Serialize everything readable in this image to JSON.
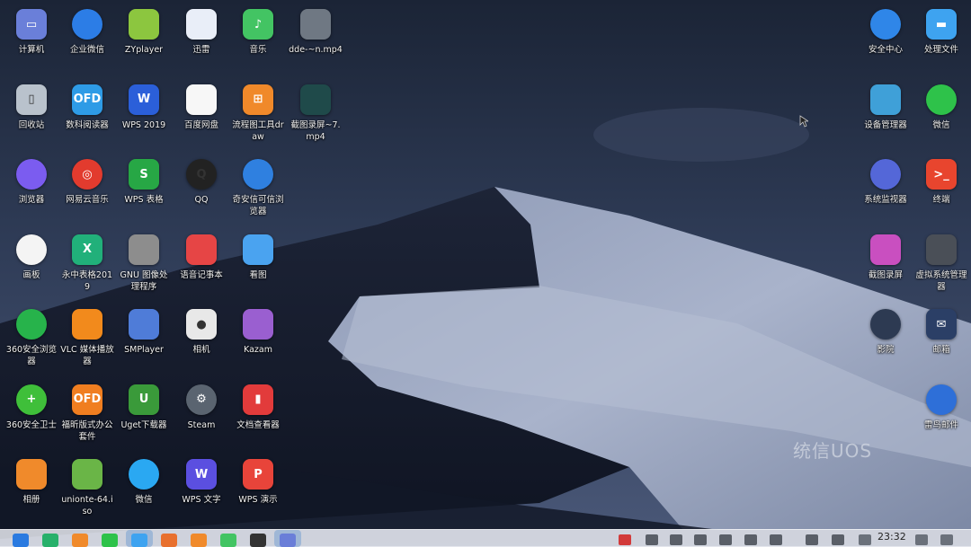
{
  "desktop": {
    "watermark": "统信UOS",
    "columns": [
      [
        {
          "label": "计算机",
          "icon": "computer-icon",
          "color": "#6a7fd9"
        },
        {
          "label": "回收站",
          "icon": "trash-icon",
          "color": "#b9c2cc"
        },
        {
          "label": "浏览器",
          "icon": "browser-icon",
          "color": "#7b5cf0"
        },
        {
          "label": "画板",
          "icon": "drawing-board-icon",
          "color": "#f4f4f4"
        },
        {
          "label": "360安全浏览器",
          "icon": "360-browser-icon",
          "color": "#27b34b"
        },
        {
          "label": "360安全卫士",
          "icon": "360-guard-icon",
          "color": "#3fbf3a"
        },
        {
          "label": "相册",
          "icon": "album-icon",
          "color": "#f08a2b"
        }
      ],
      [
        {
          "label": "企业微信",
          "icon": "wecom-icon",
          "color": "#2c7de6"
        },
        {
          "label": "数科阅读器",
          "icon": "ofd-reader-icon",
          "color": "#2e9be6"
        },
        {
          "label": "网易云音乐",
          "icon": "netease-music-icon",
          "color": "#e23b2e"
        },
        {
          "label": "永中表格2019",
          "icon": "yozo-sheet-icon",
          "color": "#21b07a"
        },
        {
          "label": "VLC 媒体播放器",
          "icon": "vlc-icon",
          "color": "#f28a1c"
        },
        {
          "label": "福昕版式办公套件",
          "icon": "foxit-ofd-icon",
          "color": "#f07e20"
        },
        {
          "label": "unionte-64.iso",
          "icon": "iso-file-icon",
          "color": "#6ab547"
        }
      ],
      [
        {
          "label": "ZYplayer",
          "icon": "zyplayer-icon",
          "color": "#8cc63f"
        },
        {
          "label": "WPS 2019",
          "icon": "wps-icon",
          "color": "#2b5fd9"
        },
        {
          "label": "WPS 表格",
          "icon": "wps-sheet-icon",
          "color": "#27a745"
        },
        {
          "label": "GNU 图像处理程序",
          "icon": "gimp-icon",
          "color": "#8d8d8d"
        },
        {
          "label": "SMPlayer",
          "icon": "smplayer-icon",
          "color": "#4f7cd8"
        },
        {
          "label": "Uget下载器",
          "icon": "uget-icon",
          "color": "#3a9a3a"
        },
        {
          "label": "微信",
          "icon": "wechat-icon",
          "color": "#2aa8f2"
        }
      ],
      [
        {
          "label": "迅雷",
          "icon": "xunlei-icon",
          "color": "#e9eef8"
        },
        {
          "label": "百度网盘",
          "icon": "baidu-netdisk-icon",
          "color": "#f7f7f7"
        },
        {
          "label": "QQ",
          "icon": "qq-icon",
          "color": "#222222"
        },
        {
          "label": "语音记事本",
          "icon": "voice-note-icon",
          "color": "#e64545"
        },
        {
          "label": "相机",
          "icon": "camera-icon",
          "color": "#e8e8e8"
        },
        {
          "label": "Steam",
          "icon": "steam-icon",
          "color": "#5a6470"
        },
        {
          "label": "WPS 文字",
          "icon": "wps-writer-icon",
          "color": "#5b4fe0"
        }
      ],
      [
        {
          "label": "音乐",
          "icon": "music-icon",
          "color": "#43c463"
        },
        {
          "label": "流程图工具draw",
          "icon": "drawio-icon",
          "color": "#f0892a"
        },
        {
          "label": "奇安信可信浏览器",
          "icon": "qianxin-browser-icon",
          "color": "#2f80e0"
        },
        {
          "label": "看图",
          "icon": "image-viewer-icon",
          "color": "#4aa3f0"
        },
        {
          "label": "Kazam",
          "icon": "kazam-icon",
          "color": "#9a5fd0"
        },
        {
          "label": "文档查看器",
          "icon": "document-viewer-icon",
          "color": "#e23b3b"
        },
        {
          "label": "WPS 演示",
          "icon": "wps-presentation-icon",
          "color": "#e8443a"
        }
      ],
      [
        {
          "label": "dde-~n.mp4",
          "icon": "video-file-icon",
          "color": "#6f7883"
        },
        {
          "label": "截图录屏~7.mp4",
          "icon": "video-thumbnail-icon",
          "color": "#1f4a4a"
        }
      ]
    ],
    "right_columns": [
      [
        {
          "label": "安全中心",
          "icon": "security-center-icon",
          "color": "#2f86e8"
        },
        {
          "label": "设备管理器",
          "icon": "device-manager-icon",
          "color": "#3fa0d8"
        },
        {
          "label": "系统监视器",
          "icon": "system-monitor-icon",
          "color": "#5467d8"
        },
        {
          "label": "截图录屏",
          "icon": "screenshot-icon",
          "color": "#c94fc0"
        },
        {
          "label": "影院",
          "icon": "movie-icon",
          "color": "#2d3a52"
        }
      ],
      [
        {
          "label": "处理文件",
          "icon": "folder-icon",
          "color": "#3ea3f0"
        },
        {
          "label": "微信",
          "icon": "wechat-icon",
          "color": "#2ec24a"
        },
        {
          "label": "终端",
          "icon": "terminal-icon",
          "color": "#e8452e"
        },
        {
          "label": "虚拟系统管理器",
          "icon": "virtual-manager-icon",
          "color": "#4a4f57"
        },
        {
          "label": "邮箱",
          "icon": "mail-icon",
          "color": "#2b3f66"
        },
        {
          "label": "雷鸟邮件",
          "icon": "thunderbird-icon",
          "color": "#2e6fd8"
        }
      ]
    ]
  },
  "dock": {
    "apps": [
      {
        "icon": "launcher-icon",
        "color": "#2a7ae0"
      },
      {
        "icon": "spreadsheet-icon",
        "color": "#27b06a"
      },
      {
        "icon": "store-icon",
        "color": "#f08a2b"
      },
      {
        "icon": "wechat-icon",
        "color": "#2ec24a"
      },
      {
        "icon": "file-manager-icon",
        "color": "#3ea3f0",
        "active": true
      },
      {
        "icon": "presentation-icon",
        "color": "#e8702e"
      },
      {
        "icon": "album-icon",
        "color": "#f08a2b"
      },
      {
        "icon": "music-icon",
        "color": "#43c463"
      },
      {
        "icon": "media-player-icon",
        "color": "#333333"
      },
      {
        "icon": "settings-icon",
        "color": "#6a7ed8",
        "active": true
      }
    ],
    "tray": [
      "record-icon",
      "network-icon",
      "volume-icon",
      "bluetooth-icon",
      "battery-icon",
      "keyboard-icon",
      "notification-icon",
      "monitor-icon",
      "power-icon"
    ],
    "clock": "23:32"
  }
}
